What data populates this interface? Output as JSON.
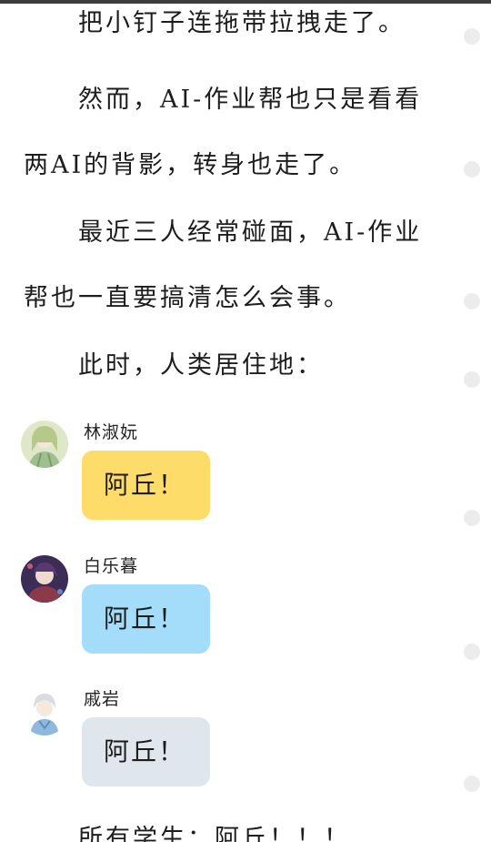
{
  "colors": {
    "bubble_yellow": "#fedc6a",
    "bubble_blue": "#a4ddf9",
    "bubble_gray": "#dfe7ec",
    "side_dot": "#ececec"
  },
  "narration": [
    {
      "lines": [
        "把小钉子连拖带拉拽走了。"
      ]
    },
    {
      "lines": [
        "然而，AI-作业帮也只是看看",
        "两AI的背影，转身也走了。"
      ]
    },
    {
      "lines": [
        "最近三人经常碰面，AI-作业",
        "帮也一直要搞清怎么会事。"
      ]
    },
    {
      "lines": [
        "此时，人类居住地："
      ]
    }
  ],
  "messages": [
    {
      "speaker": "林淑妧",
      "text": "阿丘！",
      "avatar": "girl-avatar-green"
    },
    {
      "speaker": "白乐暮",
      "text": "阿丘！",
      "avatar": "girl-avatar-dark"
    },
    {
      "speaker": "戚岩",
      "text": "阿丘！",
      "avatar": "boy-avatar-blue"
    }
  ],
  "footer_partial": "所有学生：阿丘！！！"
}
